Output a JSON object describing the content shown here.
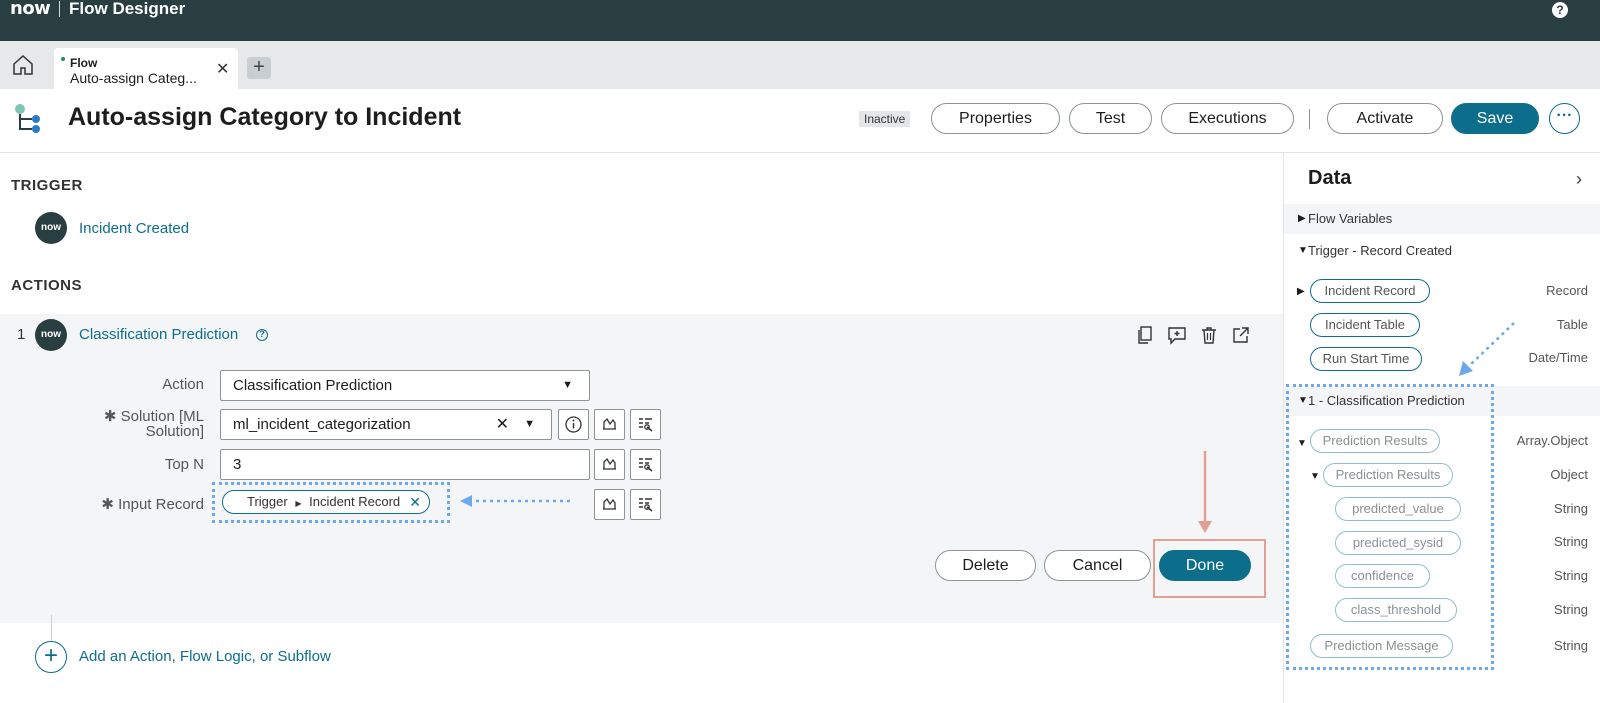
{
  "topbar": {
    "logo": "now",
    "app_title": "Flow Designer",
    "help": "?"
  },
  "tabs": [
    {
      "kind": "Flow",
      "title": "Auto-assign Categ..."
    }
  ],
  "tab_add": "+",
  "header": {
    "title": "Auto-assign Category to Incident",
    "status": "Inactive",
    "buttons": {
      "properties": "Properties",
      "test": "Test",
      "executions": "Executions",
      "activate": "Activate",
      "save": "Save",
      "more": "···"
    }
  },
  "trigger": {
    "section": "TRIGGER",
    "badge": "now",
    "name": "Incident Created"
  },
  "actions": {
    "section": "ACTIONS",
    "items": [
      {
        "number": "1",
        "badge": "now",
        "name": "Classification Prediction"
      }
    ],
    "form": {
      "action_label": "Action",
      "action_value": "Classification Prediction",
      "solution_label_1": "✱ Solution [ML",
      "solution_label_2": "Solution]",
      "solution_value": "ml_incident_categorization",
      "topn_label": "Top N",
      "topn_value": "3",
      "input_label": "✱ Input Record",
      "input_token_a": "Trigger",
      "input_token_b": "Incident Record"
    },
    "buttons": {
      "delete": "Delete",
      "cancel": "Cancel",
      "done": "Done"
    },
    "add_label": "Add an Action, Flow Logic, or Subflow"
  },
  "data_panel": {
    "title": "Data",
    "groups": {
      "flow_vars": "Flow Variables",
      "trigger": "Trigger - Record Created",
      "classification": "1 - Classification Prediction"
    },
    "trigger_pills": [
      {
        "label": "Incident Record",
        "type": "Record"
      },
      {
        "label": "Incident Table",
        "type": "Table"
      },
      {
        "label": "Run Start Time",
        "type": "Date/Time"
      }
    ],
    "prediction_pills": [
      {
        "label": "Prediction Results",
        "type": "Array.Object"
      },
      {
        "label": "Prediction Results",
        "type": "Object"
      },
      {
        "label": "predicted_value",
        "type": "String"
      },
      {
        "label": "predicted_sysid",
        "type": "String"
      },
      {
        "label": "confidence",
        "type": "String"
      },
      {
        "label": "class_threshold",
        "type": "String"
      },
      {
        "label": "Prediction Message",
        "type": "String"
      }
    ]
  },
  "colors": {
    "topbar": "#293e40",
    "primary": "#0d6e8c",
    "highlight_blue": "#6ba8f0",
    "highlight_red": "#e2a093"
  }
}
